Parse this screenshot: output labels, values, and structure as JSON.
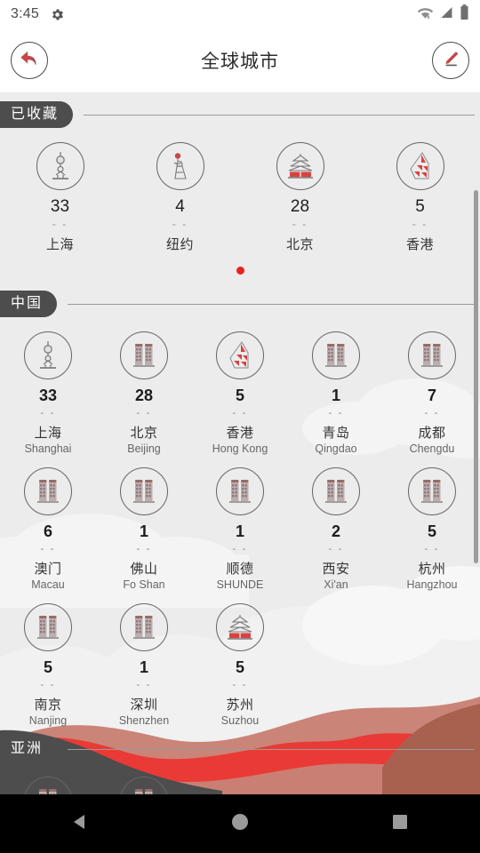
{
  "status_bar": {
    "clock": "3:45",
    "gear_icon": "gear-icon",
    "wifi_icon": "wifi-off-icon",
    "signal_icon": "cellular-signal-icon",
    "battery_icon": "battery-icon"
  },
  "app_bar": {
    "back_icon": "back-arrow-icon",
    "title": "全球城市",
    "edit_icon": "pencil-edit-icon"
  },
  "accent": {
    "red": "#e8231f",
    "pencil_red": "#c4474a",
    "pill_gray": "#4d4d4d",
    "page_bg": "#ececec"
  },
  "sections": [
    {
      "id": "favorites",
      "title": "已收藏",
      "columns": 4,
      "cities": [
        {
          "icon": "pearl-tower-icon",
          "count": "33",
          "sub": "- -",
          "name": "上海",
          "en": ""
        },
        {
          "icon": "statue-of-liberty-icon",
          "count": "4",
          "sub": "- -",
          "name": "纽约",
          "en": ""
        },
        {
          "icon": "temple-of-heaven-icon",
          "count": "28",
          "sub": "- -",
          "name": "北京",
          "en": ""
        },
        {
          "icon": "boc-tower-icon",
          "count": "5",
          "sub": "- -",
          "name": "香港",
          "en": ""
        }
      ],
      "page_dots": 1,
      "active_dot": 0
    },
    {
      "id": "china",
      "title": "中国",
      "columns": 5,
      "cities": [
        {
          "icon": "pearl-tower-icon",
          "count": "33",
          "sub": "- -",
          "name": "上海",
          "en": "Shanghai"
        },
        {
          "icon": "twin-towers-icon",
          "count": "28",
          "sub": "- -",
          "name": "北京",
          "en": "Beijing"
        },
        {
          "icon": "boc-tower-icon",
          "count": "5",
          "sub": "- -",
          "name": "香港",
          "en": "Hong Kong"
        },
        {
          "icon": "twin-towers-icon",
          "count": "1",
          "sub": "- -",
          "name": "青岛",
          "en": "Qingdao"
        },
        {
          "icon": "twin-towers-icon",
          "count": "7",
          "sub": "- -",
          "name": "成都",
          "en": "Chengdu"
        },
        {
          "icon": "twin-towers-icon",
          "count": "6",
          "sub": "- -",
          "name": "澳门",
          "en": "Macau"
        },
        {
          "icon": "twin-towers-icon",
          "count": "1",
          "sub": "- -",
          "name": "佛山",
          "en": "Fo Shan"
        },
        {
          "icon": "twin-towers-icon",
          "count": "1",
          "sub": "- -",
          "name": "顺德",
          "en": "SHUNDE"
        },
        {
          "icon": "twin-towers-icon",
          "count": "2",
          "sub": "- -",
          "name": "西安",
          "en": "Xi'an"
        },
        {
          "icon": "twin-towers-icon",
          "count": "5",
          "sub": "- -",
          "name": "杭州",
          "en": "Hangzhou"
        },
        {
          "icon": "twin-towers-icon",
          "count": "5",
          "sub": "- -",
          "name": "南京",
          "en": "Nanjing"
        },
        {
          "icon": "twin-towers-icon",
          "count": "1",
          "sub": "- -",
          "name": "深圳",
          "en": "Shenzhen"
        },
        {
          "icon": "temple-of-heaven-icon",
          "count": "5",
          "sub": "- -",
          "name": "苏州",
          "en": "Suzhou"
        }
      ]
    },
    {
      "id": "asia",
      "title": "亚洲",
      "columns": 5,
      "cities": [
        {
          "icon": "twin-towers-icon",
          "count": "",
          "sub": "",
          "name": "",
          "en": ""
        },
        {
          "icon": "twin-towers-icon",
          "count": "",
          "sub": "",
          "name": "",
          "en": ""
        }
      ]
    }
  ],
  "nav_bar": {
    "back_label": "back-triangle-icon",
    "home_label": "home-circle-icon",
    "recents_label": "recents-square-icon"
  }
}
